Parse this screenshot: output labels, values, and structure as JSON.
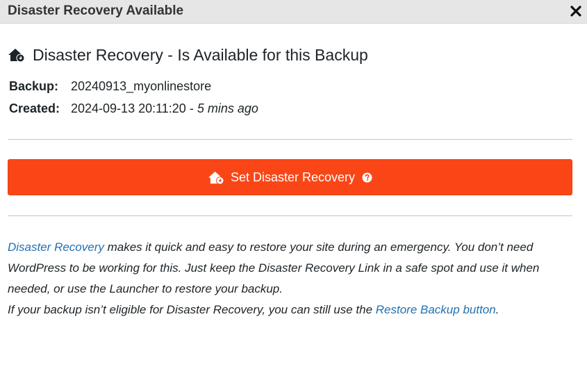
{
  "dialog": {
    "title": "Disaster Recovery Available",
    "close_icon": "close-icon"
  },
  "heading": {
    "icon": "house-fire-icon",
    "text": "Disaster Recovery - Is Available for this Backup"
  },
  "details": {
    "backup_label": "Backup:",
    "backup_value": "20240913_myonlinestore",
    "created_label": "Created:",
    "created_date": "2024-09-13 20:11:20",
    "created_separator": " - ",
    "created_ago": "5 mins ago"
  },
  "action": {
    "button_label": "Set Disaster Recovery",
    "button_icon": "house-fire-icon",
    "help_icon": "question-circle-icon",
    "button_color": "#fa4616"
  },
  "description": {
    "link_disaster_recovery": "Disaster Recovery",
    "paragraph_1_rest": " makes it quick and easy to restore your site during an emergency. You don’t need WordPress to be working for this. Just keep the Disaster Recovery Link in a safe spot and use it when needed, or use the Launcher to restore your backup.",
    "paragraph_2_text": "If your backup isn’t eligible for Disaster Recovery, you can still use the ",
    "link_restore_backup": "Restore Backup button",
    "paragraph_2_end": ".",
    "link_color": "#2271b1"
  }
}
